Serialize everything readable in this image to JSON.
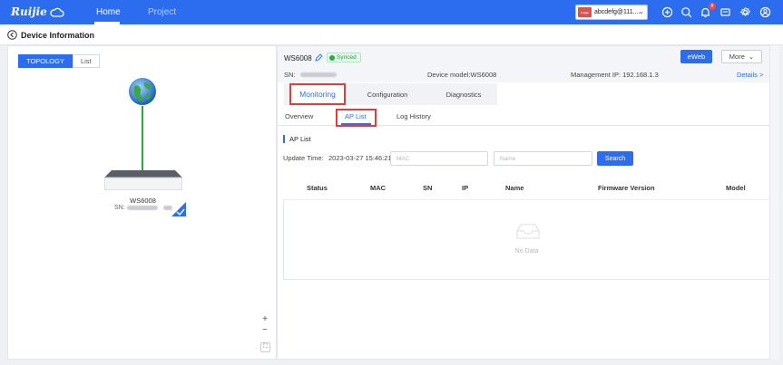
{
  "nav": {
    "logo": "Ruijie",
    "tabs": [
      "Home",
      "Project"
    ],
    "account": {
      "badge": "Logo",
      "name": "abcdefg@111...."
    },
    "notification_count": "8"
  },
  "header": {
    "title": "Device Information"
  },
  "topology": {
    "toggle": [
      "TOPOLOGY",
      "List"
    ],
    "device_name": "WS6008",
    "device_sn_label": "SN:",
    "zoom_in": "+",
    "zoom_out": "−"
  },
  "device": {
    "name": "WS6008",
    "status": "Synced",
    "sn_label": "SN:",
    "model": "Device model:WS6008",
    "ip": "Management IP:  192.168.1.3",
    "details": "Details >",
    "eweb": "eWeb",
    "more": "More"
  },
  "main_tabs": [
    "Monitoring",
    "Configuration",
    "Diagnostics"
  ],
  "sub_tabs": [
    "Overview",
    "AP List",
    "Log History"
  ],
  "ap_list": {
    "title": "AP List",
    "update_label": "Update Time:",
    "update_value": "2023-03-27 15:46:21",
    "mac_placeholder": "MAC",
    "name_placeholder": "Name",
    "search": "Search",
    "columns": [
      "Status",
      "MAC",
      "SN",
      "IP",
      "Name",
      "Firmware Version",
      "Model"
    ],
    "empty_text": "No Data"
  },
  "colors": {
    "primary": "#2c6df0",
    "highlight": "#e23b3b",
    "success": "#2aa745"
  }
}
